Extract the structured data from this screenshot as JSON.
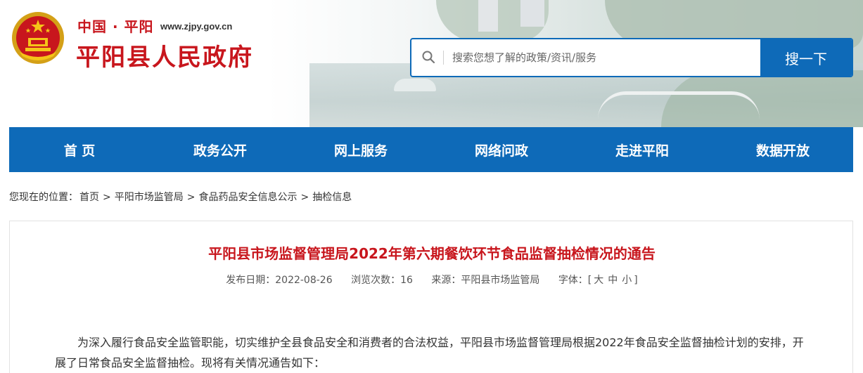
{
  "header": {
    "site_tag": "中国 · 平阳",
    "site_url": "www.zjpy.gov.cn",
    "site_name": "平阳县人民政府",
    "search": {
      "placeholder": "搜索您想了解的政策/资讯/服务",
      "button_label": "搜一下"
    }
  },
  "nav": {
    "items": [
      {
        "label": "首 页"
      },
      {
        "label": "政务公开"
      },
      {
        "label": "网上服务"
      },
      {
        "label": "网络问政"
      },
      {
        "label": "走进平阳"
      },
      {
        "label": "数据开放"
      }
    ]
  },
  "breadcrumb": {
    "prefix": "您现在的位置：",
    "items": [
      "首页",
      "平阳市场监管局",
      "食品药品安全信息公示",
      "抽检信息"
    ],
    "separator": ">"
  },
  "article": {
    "title": "平阳县市场监督管理局2022年第六期餐饮环节食品监督抽检情况的通告",
    "meta": {
      "date": "发布日期：2022-08-26",
      "views": "浏览次数：16",
      "source": "来源：平阳县市场监管局",
      "font_size_label": "字体：[",
      "size_large": "大",
      "size_medium": "中",
      "size_small": "小",
      "font_size_close": "]"
    },
    "paragraph_1": "为深入履行食品安全监管职能，切实维护全县食品安全和消费者的合法权益，平阳县市场监督管理局根据2022年食品安全监督抽检计划的安排，开展了日常食品安全监督抽检。现将有关情况通告如下："
  },
  "colors": {
    "brand_red": "#c8161d",
    "nav_blue": "#0e6ab8"
  },
  "icons": {
    "emblem": "national-emblem-icon",
    "search": "search-icon"
  }
}
